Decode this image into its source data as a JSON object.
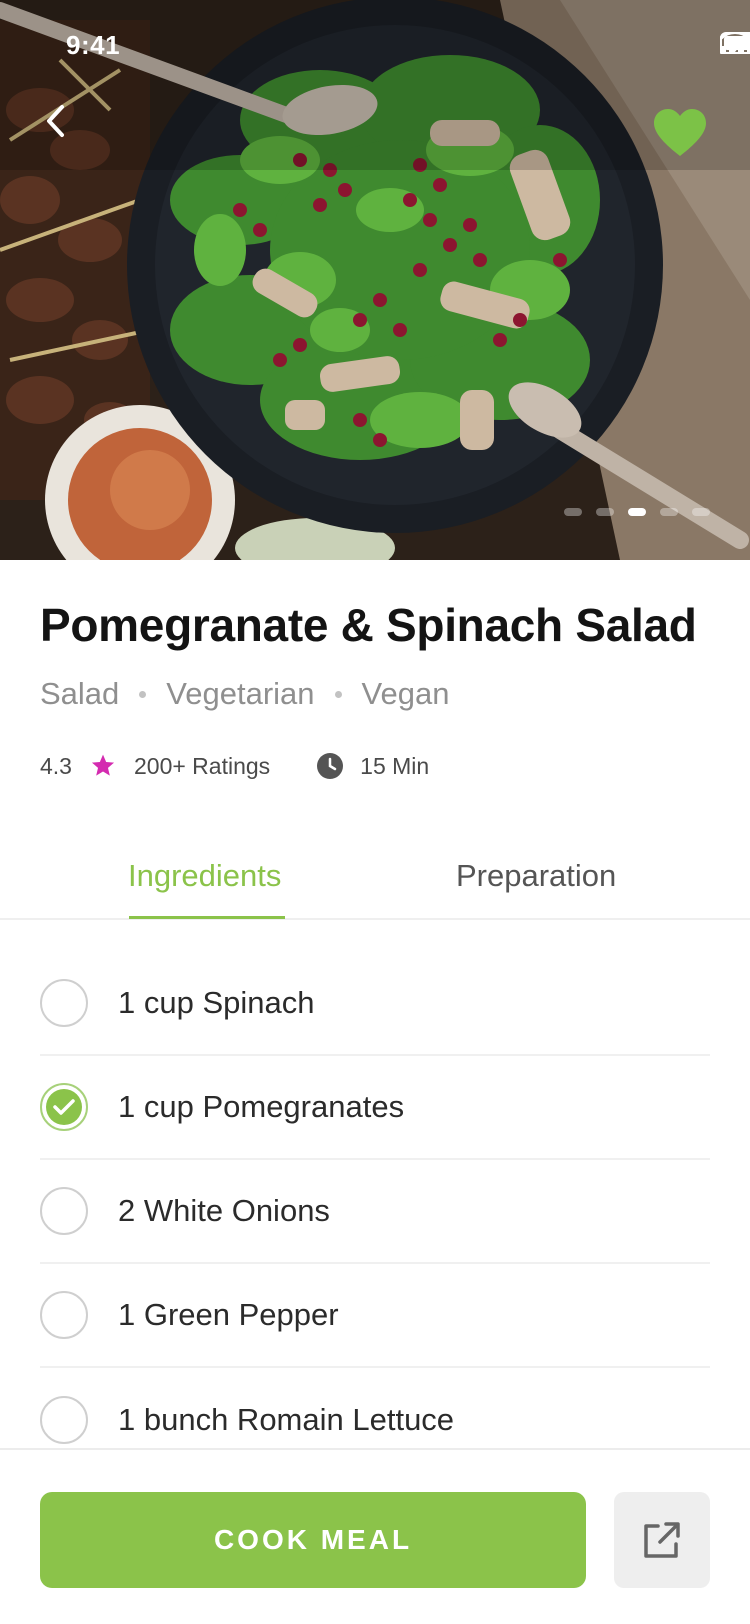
{
  "status_bar": {
    "time": "9:41"
  },
  "hero": {
    "image_alt": "",
    "carousel": {
      "count": 5,
      "active_index": 2
    }
  },
  "recipe": {
    "title": "Pomegranate & Spinach Salad",
    "tags": [
      "Salad",
      "Vegetarian",
      "Vegan"
    ],
    "rating": "4.3",
    "ratings_count": "200+ Ratings",
    "time": "15 Min"
  },
  "tabs": [
    {
      "label": "Ingredients",
      "active": true
    },
    {
      "label": "Preparation",
      "active": false
    }
  ],
  "ingredients": [
    {
      "text": "1 cup Spinach",
      "checked": false
    },
    {
      "text": "1 cup Pomegranates",
      "checked": true
    },
    {
      "text": "2 White Onions",
      "checked": false
    },
    {
      "text": "1 Green Pepper",
      "checked": false
    },
    {
      "text": "1 bunch Romain Lettuce",
      "checked": false
    }
  ],
  "actions": {
    "cook_label": "COOK MEAL"
  },
  "icons": {
    "back": "chevron-left-icon",
    "favorite": "heart-icon",
    "star": "star-icon",
    "clock": "clock-icon",
    "share": "external-link-icon",
    "check": "check-icon"
  },
  "colors": {
    "accent": "#8bc34a",
    "star": "#d42bb0",
    "text_dark": "#141414",
    "text_muted": "#8f8f8f"
  }
}
